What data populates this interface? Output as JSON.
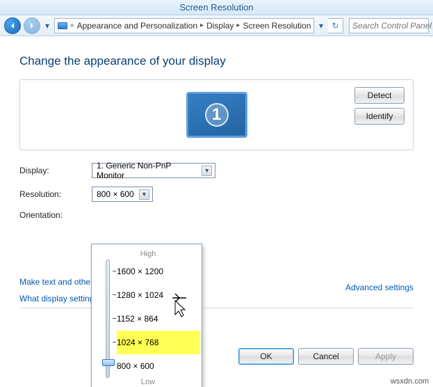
{
  "window": {
    "title": "Screen Resolution"
  },
  "breadcrumb": {
    "item0": "Appearance and Personalization",
    "item1": "Display",
    "item2": "Screen Resolution"
  },
  "search": {
    "placeholder": "Search Control Panel"
  },
  "page": {
    "heading": "Change the appearance of your display",
    "detect": "Detect",
    "identify": "Identify",
    "monitor_number": "1"
  },
  "form": {
    "display_label": "Display:",
    "display_value": "1. Generic Non-PnP Monitor",
    "resolution_label": "Resolution:",
    "resolution_value": "800 × 600",
    "orientation_label": "Orientation:"
  },
  "slider": {
    "high": "High",
    "low": "Low",
    "opts": {
      "o0": "1600 × 1200",
      "o1": "1280 × 1024",
      "o2": "1152 × 864",
      "o3": "1024 × 768",
      "o4": "800 × 600"
    }
  },
  "links": {
    "text_items": "Make text and other",
    "what_settings": "What display setting",
    "advanced": "Advanced settings"
  },
  "buttons": {
    "ok": "OK",
    "cancel": "Cancel",
    "apply": "Apply"
  },
  "watermark": "wsxdn.com"
}
